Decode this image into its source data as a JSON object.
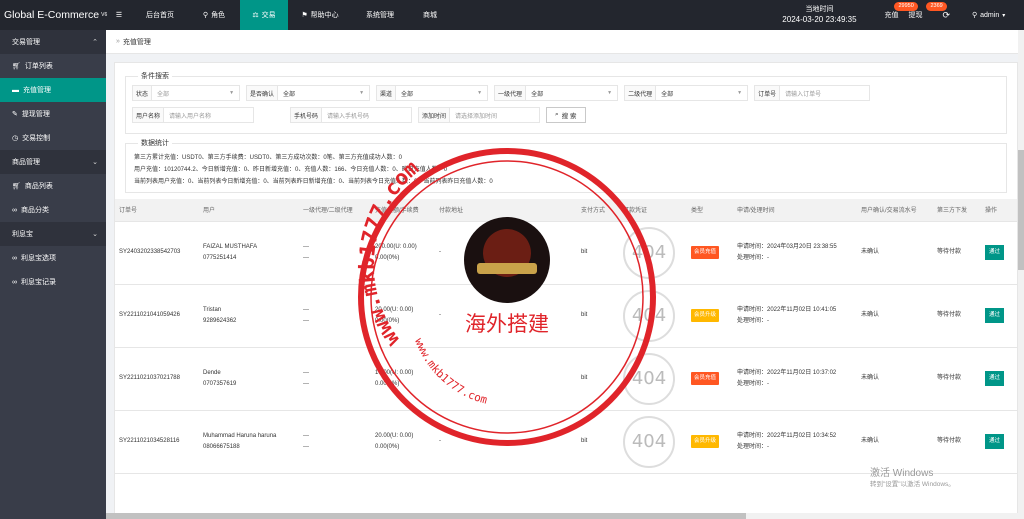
{
  "brand": {
    "name": "Global E-Commerce",
    "version": "V6"
  },
  "topnav": [
    {
      "label": "后台首页",
      "icon": "house-icon"
    },
    {
      "label": "角色",
      "icon": "user-icon"
    },
    {
      "label": "交易",
      "icon": "scale-icon",
      "active": true
    },
    {
      "label": "帮助中心",
      "icon": "flag-icon"
    },
    {
      "label": "系统管理",
      "icon": ""
    },
    {
      "label": "商城",
      "icon": ""
    }
  ],
  "top_right": {
    "time_label": "当地时间",
    "time_value": "2024-03-20 23:49:35",
    "recharge": {
      "label": "充值",
      "badge": "29950"
    },
    "withdraw": {
      "label": "提现",
      "badge": "2369"
    },
    "admin": "admin"
  },
  "sidebar": [
    {
      "type": "group",
      "label": "交易管理"
    },
    {
      "type": "item",
      "label": "订单列表",
      "icon": "cart-icon"
    },
    {
      "type": "item",
      "label": "充值管理",
      "icon": "card-icon",
      "active": true
    },
    {
      "type": "item",
      "label": "提现管理",
      "icon": "wrench-icon"
    },
    {
      "type": "item",
      "label": "交易控制",
      "icon": "clock-icon"
    },
    {
      "type": "group",
      "label": "商品管理"
    },
    {
      "type": "item",
      "label": "商品列表",
      "icon": "cart-icon"
    },
    {
      "type": "item",
      "label": "商品分类",
      "icon": "link-icon"
    },
    {
      "type": "group",
      "label": "利息宝"
    },
    {
      "type": "item",
      "label": "利息宝选项",
      "icon": "link-icon"
    },
    {
      "type": "item",
      "label": "利息宝记录",
      "icon": "link-icon"
    }
  ],
  "breadcrumb": "充值管理",
  "filters": {
    "legend": "条件搜索",
    "status": {
      "label": "状态",
      "placeholder": "全部"
    },
    "confirm": {
      "label": "是否确认",
      "value": "全部"
    },
    "channel": {
      "label": "渠道",
      "value": "全部"
    },
    "agent1": {
      "label": "一级代理",
      "value": "全部"
    },
    "agent2": {
      "label": "二级代理",
      "value": "全部"
    },
    "order_no": {
      "label": "订单号",
      "placeholder": "请输入订单号"
    },
    "username": {
      "label": "用户名称",
      "placeholder": "请输入用户名称"
    },
    "phone": {
      "label": "手机号码",
      "placeholder": "请输入手机号码"
    },
    "added": {
      "label": "添加时间",
      "placeholder": "请选择添加时间"
    },
    "search_btn": "搜 索"
  },
  "stats": {
    "legend": "数据统计",
    "lines": [
      "第三方累计充值：USDT0、第三方手续费：USDT0、第三方成功次数：0笔、第三方充值成功人数：0",
      "用户充值：10120744.2、今日新增充值：0、昨日新增充值：0、充值人数：166、今日充值人数：0、昨日充值人数：0",
      "当前列表用户充值：0、当前列表今日新增充值：0、当前列表昨日新增充值：0、当前列表今日充值人数：0、当前列表昨日充值人数：0"
    ]
  },
  "table": {
    "headers": [
      "订单号",
      "用户",
      "一级代理/二级代理",
      "充值金额/手续费",
      "付款地址",
      "支付方式",
      "打款凭证",
      "类型",
      "申请/处理时间",
      "用户确认/交易流水号",
      "第三方下发",
      "操作"
    ],
    "rows": [
      {
        "order": "SY2403202338542703",
        "name": "FAIZAL MUSTHAFA",
        "phone": "0775251414",
        "agent1": "---",
        "agent2": "---",
        "amount": "200.00(U: 0.00)",
        "fee": "0.00(0%)",
        "address": "-",
        "method": "bit",
        "proof": "404",
        "type": "会员充值",
        "type_color": "red",
        "apply": "申请时间：2024年03月20日 23:38:55",
        "process": "处理时间：-",
        "confirm": "未确认",
        "third": "等待付款",
        "action": "通过"
      },
      {
        "order": "SY2211021041059426",
        "name": "Tristan",
        "phone": "9289624362",
        "agent1": "---",
        "agent2": "---",
        "amount": "20.00(U: 0.00)",
        "fee": "0.00(0%)",
        "address": "-",
        "method": "bit",
        "proof": "404",
        "type": "会员升级",
        "type_color": "orange",
        "apply": "申请时间：2022年11月02日 10:41:05",
        "process": "处理时间：-",
        "confirm": "未确认",
        "third": "等待付款",
        "action": "通过"
      },
      {
        "order": "SY2211021037021788",
        "name": "Dende",
        "phone": "0707357619",
        "agent1": "---",
        "agent2": "---",
        "amount": "10.00(U: 0.00)",
        "fee": "0.00(0%)",
        "address": "-",
        "method": "bit",
        "proof": "404",
        "type": "会员充值",
        "type_color": "red",
        "apply": "申请时间：2022年11月02日 10:37:02",
        "process": "处理时间：-",
        "confirm": "未确认",
        "third": "等待付款",
        "action": "通过"
      },
      {
        "order": "SY2211021034528116",
        "name": "Muhammad Haruna haruna",
        "phone": "08066675188",
        "agent1": "---",
        "agent2": "---",
        "amount": "20.00(U: 0.00)",
        "fee": "0.00(0%)",
        "address": "-",
        "method": "bit",
        "proof": "404",
        "type": "会员升级",
        "type_color": "orange",
        "apply": "申请时间：2022年11月02日 10:34:52",
        "process": "处理时间：-",
        "confirm": "未确认",
        "third": "等待付款",
        "action": "通过"
      }
    ]
  },
  "watermark": {
    "url_text": "www.mkb1777.com",
    "cn_text": "海外搭建"
  },
  "windows_activation": {
    "title": "激活 Windows",
    "subtitle": "转到\"设置\"以激活 Windows。"
  }
}
